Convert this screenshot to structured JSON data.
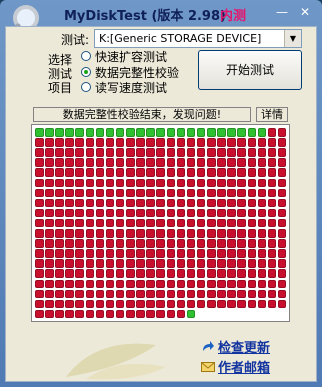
{
  "window": {
    "title": "MyDiskTest (版本 2.98)",
    "beta_tag": "内测",
    "minimize_glyph": "—",
    "close_glyph": "✕"
  },
  "test_section": {
    "label": "测试:",
    "device_value": "K:[Generic STORAGE DEVICE]"
  },
  "options": {
    "side_label_lines": [
      "选择",
      "测试",
      "项目"
    ],
    "items": [
      {
        "label": "快速扩容测试",
        "checked": false
      },
      {
        "label": "数据完整性校验",
        "checked": true
      },
      {
        "label": "读写速度测试",
        "checked": false
      }
    ]
  },
  "start_button_label": "开始测试",
  "status_text": "数据完整性校验结束，发现问题!",
  "detail_button_label": "详情",
  "block_map": {
    "columns": 25,
    "rows": 19,
    "first_row_green": 23,
    "green_last_row_count": 16,
    "good_color": "#2ec02e",
    "bad_color": "#c8102e",
    "empty_color": "#ffffff"
  },
  "links": {
    "check_update": "检查更新",
    "author_mail": "作者邮箱"
  }
}
